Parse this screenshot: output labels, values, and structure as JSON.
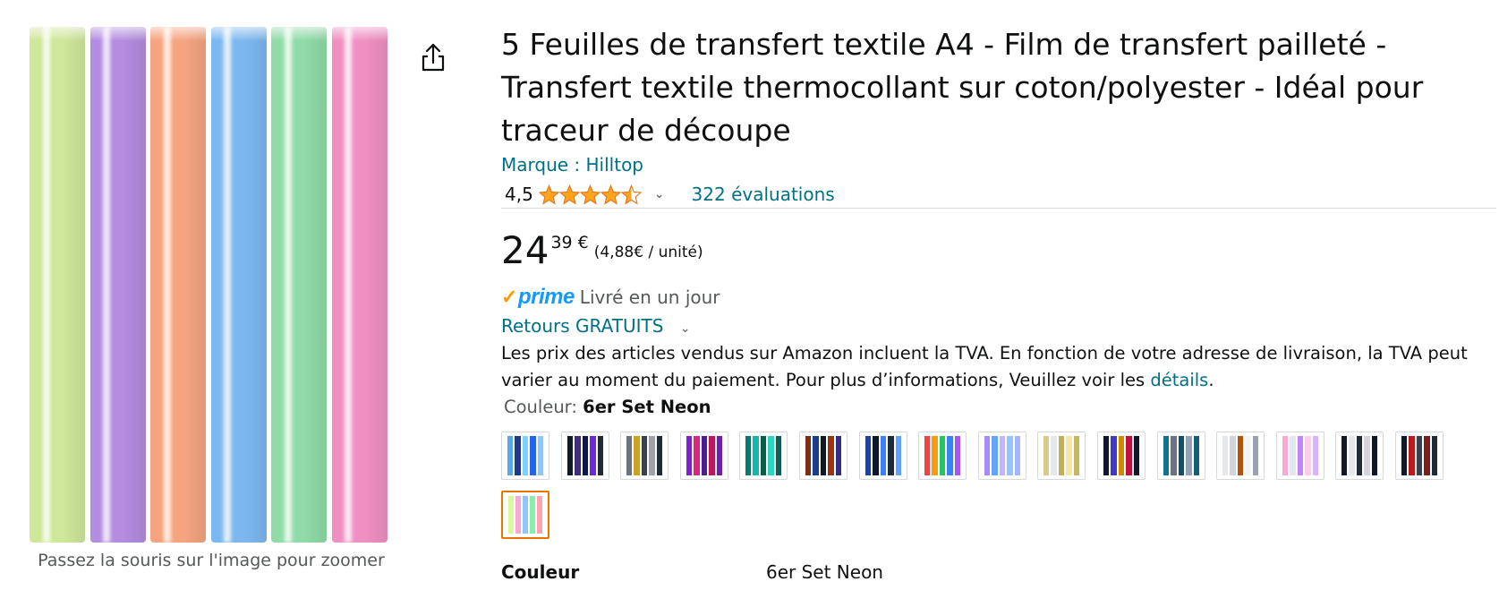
{
  "image_panel": {
    "zoom_hint": "Passez la souris sur l'image pour zoomer",
    "roll_colors": [
      "#cfe79a",
      "#b48ce0",
      "#f5a47f",
      "#7cb8ef",
      "#90dba7",
      "#f08fc2"
    ],
    "share_icon": "share-icon"
  },
  "product": {
    "title": "5 Feuilles de transfert textile A4 - Film de transfert pailleté - Transfert textile thermocollant sur coton/polyester - Idéal pour traceur de découpe",
    "brand": "Marque : Hilltop",
    "rating": {
      "value_text": "4,5",
      "value": 4.5,
      "out_of": 5,
      "reviews": "322 évaluations",
      "star_color": "#ffa41c"
    },
    "price": {
      "whole": "24",
      "fraction": "39 €",
      "per_unit": "(4,88€ / unité)"
    },
    "delivery": {
      "prime_check": "✓",
      "prime_label": "prime",
      "text": "Livré en un jour"
    },
    "returns": "Retours GRATUITS",
    "vat_note": {
      "text": "Les prix des articles vendus sur Amazon incluent la TVA. En fonction de votre adresse de livraison, la TVA peut varier au moment du paiement. Pour plus d’informations, Veuillez voir les",
      "link": "détails",
      "end": "."
    },
    "color": {
      "label": "Couleur:",
      "selected": "6er Set Neon",
      "swatches": [
        {
          "colors": [
            "#5aa9e6",
            "#1e3a8a",
            "#7dd3fc",
            "#2563eb",
            "#93c5fd"
          ]
        },
        {
          "colors": [
            "#111827",
            "#3b2f7a",
            "#0b1a4a",
            "#6d28d9",
            "#1f2937"
          ]
        },
        {
          "colors": [
            "#6b7280",
            "#c9a227",
            "#374151",
            "#9ca3af",
            "#1f2937"
          ]
        },
        {
          "colors": [
            "#7e22ce",
            "#db2777",
            "#4c1d95",
            "#be185d",
            "#6b21a8"
          ]
        },
        {
          "colors": [
            "#0f766e",
            "#14b8a6",
            "#065f46",
            "#2dd4bf",
            "#115e59"
          ]
        },
        {
          "colors": [
            "#7c2d12",
            "#1e3a8a",
            "#111827",
            "#9a3412",
            "#312e81"
          ]
        },
        {
          "colors": [
            "#1e40af",
            "#0f172a",
            "#3b82f6",
            "#1e293b",
            "#60a5fa"
          ]
        },
        {
          "colors": [
            "#ef4444",
            "#f59e0b",
            "#22c55e",
            "#3b82f6",
            "#a855f7"
          ]
        },
        {
          "colors": [
            "#a78bfa",
            "#60a5fa",
            "#c4b5fd",
            "#93c5fd",
            "#a5b4fc"
          ]
        },
        {
          "colors": [
            "#d6c98a",
            "#e5e7eb",
            "#bfae5a",
            "#f3e8a8",
            "#c8b560"
          ]
        },
        {
          "colors": [
            "#0f172a",
            "#4338ca",
            "#ca8a04",
            "#be123c",
            "#111827"
          ]
        },
        {
          "colors": [
            "#0e7490",
            "#6b7280",
            "#164e63",
            "#94a3b8",
            "#155e75"
          ]
        },
        {
          "colors": [
            "#e5e7eb",
            "#d1d5db",
            "#b45309",
            "#f3f4f6",
            "#9ca3af"
          ]
        },
        {
          "colors": [
            "#f9a8d4",
            "#e5e7eb",
            "#c084fc",
            "#fbcfe8",
            "#d8b4fe"
          ]
        },
        {
          "colors": [
            "#111827",
            "#e5e7eb",
            "#1f2937",
            "#d1d5db",
            "#0f172a"
          ]
        },
        {
          "colors": [
            "#111827",
            "#b91c1c",
            "#374151",
            "#7f1d1d",
            "#1f2937"
          ]
        },
        {
          "colors": [
            "#d9f99d",
            "#f9a8d4",
            "#93c5fd",
            "#86efac",
            "#fda4af"
          ],
          "selected": true
        }
      ]
    },
    "spec": {
      "name": "Couleur",
      "value": "6er Set Neon"
    }
  }
}
